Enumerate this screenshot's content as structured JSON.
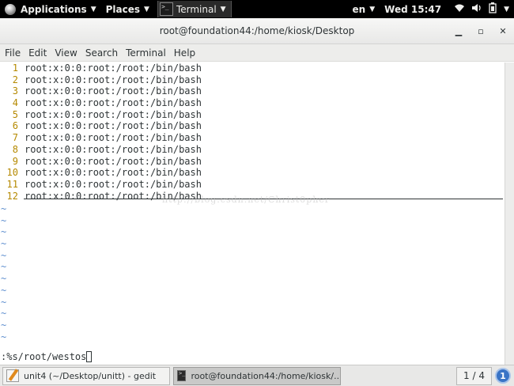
{
  "topbar": {
    "applications": "Applications",
    "places": "Places",
    "terminal": "Terminal",
    "language": "en",
    "clock": "Wed 15:47"
  },
  "window": {
    "title": "root@foundation44:/home/kiosk/Desktop"
  },
  "menubar": {
    "items": [
      "File",
      "Edit",
      "View",
      "Search",
      "Terminal",
      "Help"
    ]
  },
  "editor": {
    "lines": [
      {
        "num": "1",
        "text": "root:x:0:0:root:/root:/bin/bash"
      },
      {
        "num": "2",
        "text": "root:x:0:0:root:/root:/bin/bash"
      },
      {
        "num": "3",
        "text": "root:x:0:0:root:/root:/bin/bash"
      },
      {
        "num": "4",
        "text": "root:x:0:0:root:/root:/bin/bash"
      },
      {
        "num": "5",
        "text": "root:x:0:0:root:/root:/bin/bash"
      },
      {
        "num": "6",
        "text": "root:x:0:0:root:/root:/bin/bash"
      },
      {
        "num": "7",
        "text": "root:x:0:0:root:/root:/bin/bash"
      },
      {
        "num": "8",
        "text": "root:x:0:0:root:/root:/bin/bash"
      },
      {
        "num": "9",
        "text": "root:x:0:0:root:/root:/bin/bash"
      },
      {
        "num": "10",
        "text": "root:x:0:0:root:/root:/bin/bash"
      },
      {
        "num": "11",
        "text": "root:x:0:0:root:/root:/bin/bash"
      },
      {
        "num": "12",
        "text": "root:x:0:0:root:/root:/bin/bash"
      }
    ],
    "tilde": "~",
    "command": ":%s/root/westos",
    "watermark": "http://blog.csdn.net/Christ0pher"
  },
  "taskbar": {
    "task1": "unit4 (~/Desktop/unitt) - gedit",
    "task2": "root@foundation44:/home/kiosk/...",
    "workspace": "1 / 4",
    "notifications": "1"
  },
  "colors": {
    "line_number": "#b58900",
    "tilde": "#5f8fcf",
    "topbar_bg": "#000000",
    "notification_blue": "#3a74c6"
  }
}
